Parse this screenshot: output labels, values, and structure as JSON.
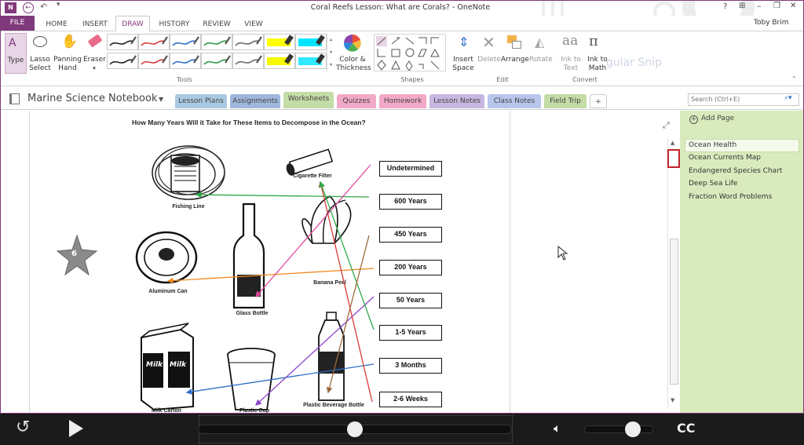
{
  "window": {
    "title": "Coral Reefs Lesson: What are Corals? - OneNote",
    "user": "Toby Brim",
    "controls": [
      "?",
      "⊞",
      "–",
      "❐",
      "✕"
    ]
  },
  "ribbon_tabs": [
    "FILE",
    "HOME",
    "INSERT",
    "DRAW",
    "HISTORY",
    "REVIEW",
    "VIEW"
  ],
  "ribbon": {
    "type": "Type",
    "lasso": [
      "Lasso",
      "Select"
    ],
    "panning": [
      "Panning",
      "Hand"
    ],
    "eraser": "Eraser",
    "color_thickness": [
      "Color &",
      "Thickness"
    ],
    "insert_space": [
      "Insert",
      "Space"
    ],
    "delete": "Delete",
    "arrange": "Arrange",
    "rotate": "Rotate",
    "ink_to_text": [
      "Ink to",
      "Text"
    ],
    "ink_to_math": [
      "Ink to",
      "Math"
    ],
    "ghost_text": "gular Snip",
    "groups": {
      "tools": "Tools",
      "shapes": "Shapes",
      "edit": "Edit",
      "convert": "Convert"
    },
    "pen_colors": [
      "#222222",
      "#d83b3b",
      "#2e6fc9",
      "#2e9a48",
      "#6a6a6a",
      "#ffff00",
      "#00e5ff",
      "#222222",
      "#d83b3b",
      "#2e6fc9",
      "#2e9a48",
      "#6a6a6a",
      "#f7f700",
      "#30e8ff"
    ]
  },
  "notebook": {
    "name": "Marine Science Notebook",
    "sections": [
      {
        "label": "Lesson Plans",
        "color": "#a9c9e2"
      },
      {
        "label": "Assignments",
        "color": "#9fb7dc"
      },
      {
        "label": "Worksheets",
        "color": "#c4dca6"
      },
      {
        "label": "Quizzes",
        "color": "#f2a9c8"
      },
      {
        "label": "Homework",
        "color": "#f2a9c8"
      },
      {
        "label": "Lesson Notes",
        "color": "#c8b7e0"
      },
      {
        "label": "Class Notes",
        "color": "#b9c6ec"
      },
      {
        "label": "Field Trip",
        "color": "#c4dca6"
      },
      {
        "label": "+",
        "color": "#ffffff"
      }
    ],
    "search_placeholder": "Search (Ctrl+E)"
  },
  "pages_panel": {
    "add_page": "Add Page",
    "pages": [
      "Ocean Health",
      "Ocean Currents Map",
      "Endangered Species Chart",
      "Deep Sea Life",
      "Fraction Word Problems"
    ]
  },
  "worksheet": {
    "title": "How Many Years Will it Take for These Items to Decompose in the Ocean?",
    "answers": [
      "Undetermined",
      "600 Years",
      "450 Years",
      "200 Years",
      "50 Years",
      "1-5 Years",
      "3 Months",
      "2-6 Weeks"
    ],
    "items": {
      "fishing_line": "Fishing Line",
      "cigarette": "Cigarette Filter",
      "banana": "Banana Peel",
      "can": "Aluminum Can",
      "bottle": "Glass Bottle",
      "milk": "Milk Carton",
      "cup": "Plastic Cup",
      "plastic_bottle": "Plastic Beverage Bottle",
      "milk_word": "Milk"
    },
    "starfish_number": "6"
  },
  "player": {
    "progress": 0.5,
    "volume": 0.7,
    "cc": "CC"
  }
}
